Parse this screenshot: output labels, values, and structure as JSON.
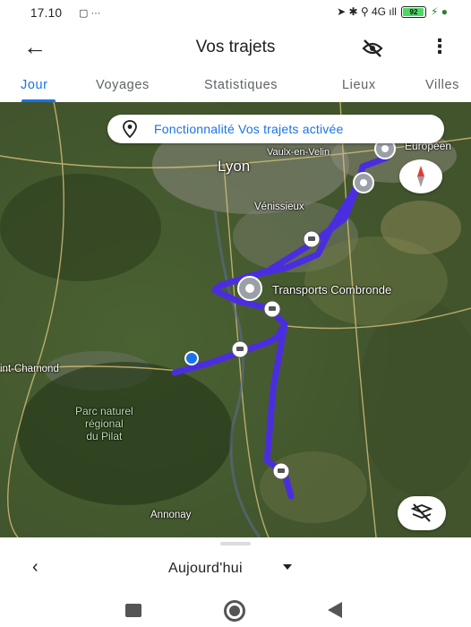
{
  "status_bar": {
    "time": "17.10",
    "left_icons": "▢ ···",
    "right_icons": "➤ ✱ ⚲ 4G ıll",
    "battery": "92",
    "charging": "⚡ ●"
  },
  "app_bar": {
    "back_icon": "arrow-back-icon",
    "title": "Vos trajets",
    "location_off_icon": "location-off-icon",
    "more_icon": "more-vert-icon"
  },
  "tabs": [
    {
      "label": "Jour",
      "active": true
    },
    {
      "label": "Voyages",
      "active": false
    },
    {
      "label": "Statistiques",
      "active": false
    },
    {
      "label": "Lieux",
      "active": false
    },
    {
      "label": "Villes",
      "active": false
    }
  ],
  "map": {
    "chip_text": "Fonctionnalité Vos trajets activée",
    "labels": {
      "lyon": "Lyon",
      "vaulx": "Vaulx-en-Velin",
      "europeen": "Européen",
      "venissieux": "Vénissieux",
      "transports": "Transports Combronde",
      "saint_chamond": "int-Chamond",
      "parc": "Parc naturel\nrégional\ndu Pilat",
      "annonay": "Annonay"
    },
    "route_color": "#4b2de0",
    "compass_icon": "compass-icon",
    "layers_icon": "hide-route-icon"
  },
  "bottom_sheet": {
    "prev_icon": "chevron-left-icon",
    "date_label": "Aujourd'hui",
    "dropdown_icon": "arrow-drop-down-icon"
  },
  "nav_bar": {
    "recents_icon": "square-icon",
    "home_icon": "home-circle-icon",
    "back_icon": "triangle-back-icon"
  }
}
